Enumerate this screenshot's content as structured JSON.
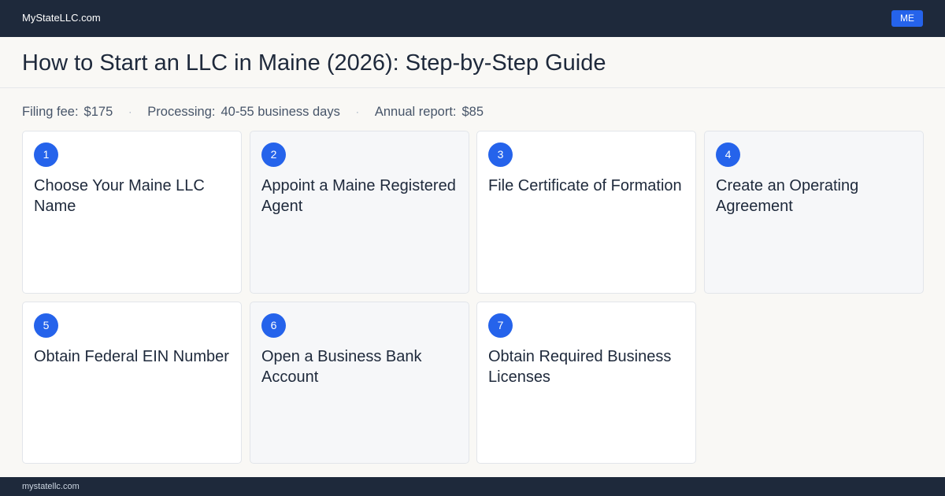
{
  "header": {
    "brand": "MyStateLLC.com",
    "state_badge": "ME"
  },
  "page": {
    "title": "How to Start an LLC in Maine (2026): Step-by-Step Guide"
  },
  "stats": [
    {
      "label": "Filing fee:",
      "value": "$175"
    },
    {
      "label": "Processing:",
      "value": "40-55 business days"
    },
    {
      "label": "Annual report:",
      "value": "$85"
    }
  ],
  "separator": "·",
  "steps": [
    {
      "number": "1",
      "title": "Choose Your Maine LLC Name"
    },
    {
      "number": "2",
      "title": "Appoint a Maine Registered Agent"
    },
    {
      "number": "3",
      "title": "File Certificate of Formation"
    },
    {
      "number": "4",
      "title": "Create an Operating Agreement"
    },
    {
      "number": "5",
      "title": "Obtain Federal EIN Number"
    },
    {
      "number": "6",
      "title": "Open a Business Bank Account"
    },
    {
      "number": "7",
      "title": "Obtain Required Business Licenses"
    }
  ],
  "footer": {
    "url": "mystatellc.com"
  }
}
